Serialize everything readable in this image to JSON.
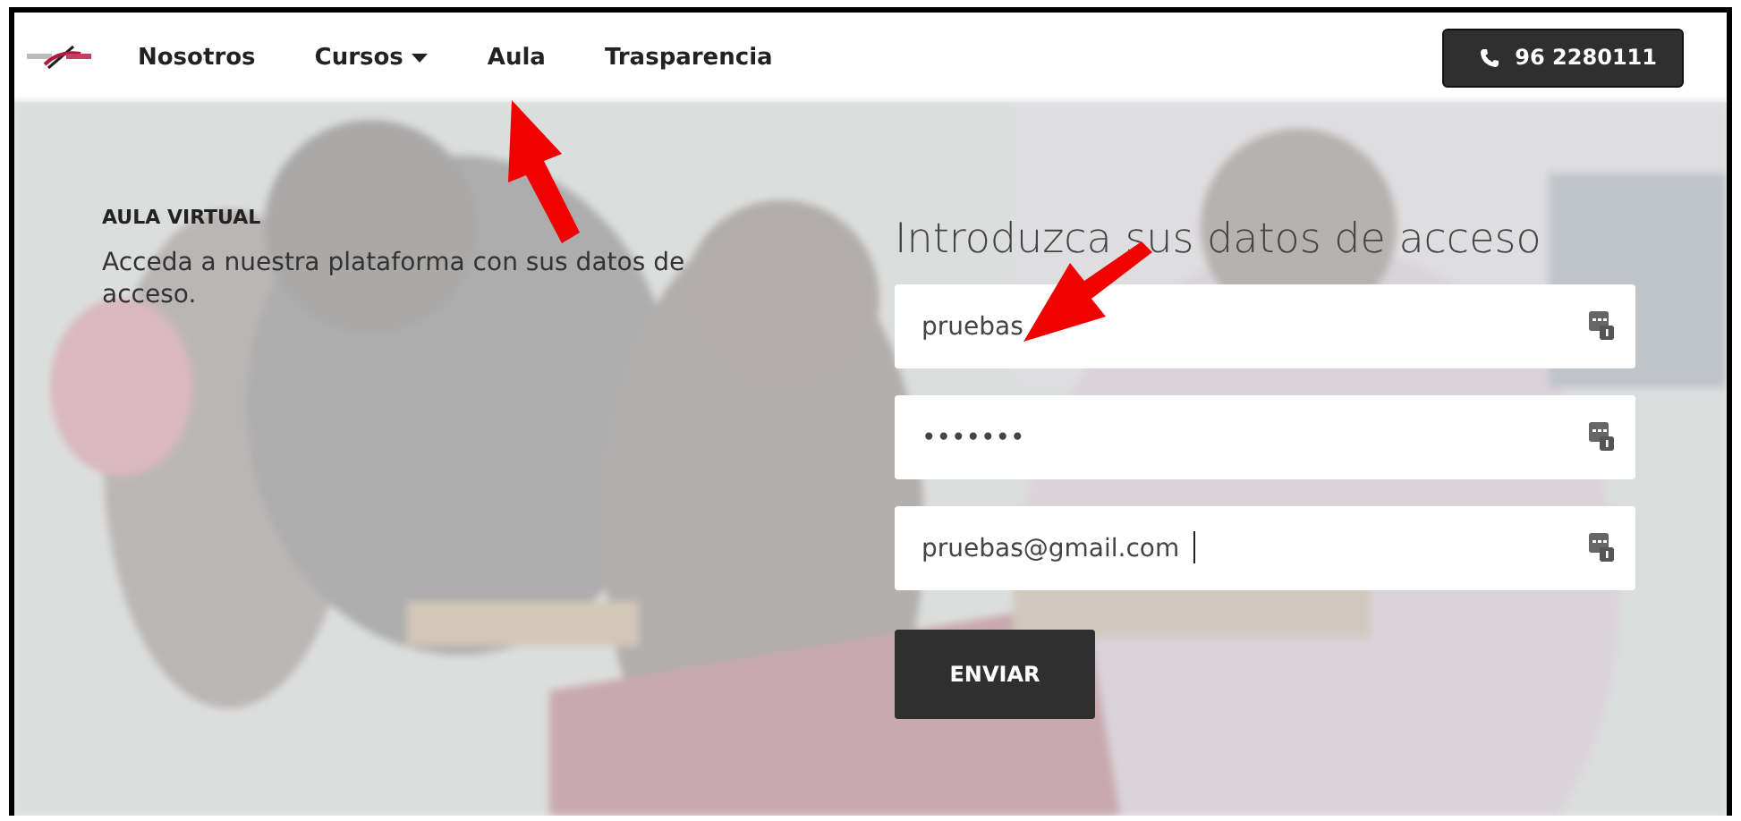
{
  "nav": {
    "items": [
      {
        "label": "Nosotros",
        "dropdown": false
      },
      {
        "label": "Cursos",
        "dropdown": true
      },
      {
        "label": "Aula",
        "dropdown": false
      },
      {
        "label": "Trasparencia",
        "dropdown": false
      }
    ],
    "phone": "96 2280111"
  },
  "hero": {
    "eyebrow": "AULA VIRTUAL",
    "intro": "Acceda a nuestra plataforma con sus datos de acceso.",
    "form_title": "Introduzca sus datos de acceso",
    "fields": [
      {
        "value": "pruebas"
      },
      {
        "value": "•••••••"
      },
      {
        "value": "pruebas@gmail.com",
        "focused": true
      }
    ],
    "submit": "ENVIAR"
  },
  "annotations": [
    {
      "kind": "arrow_up"
    },
    {
      "kind": "arrow_down_left"
    }
  ]
}
